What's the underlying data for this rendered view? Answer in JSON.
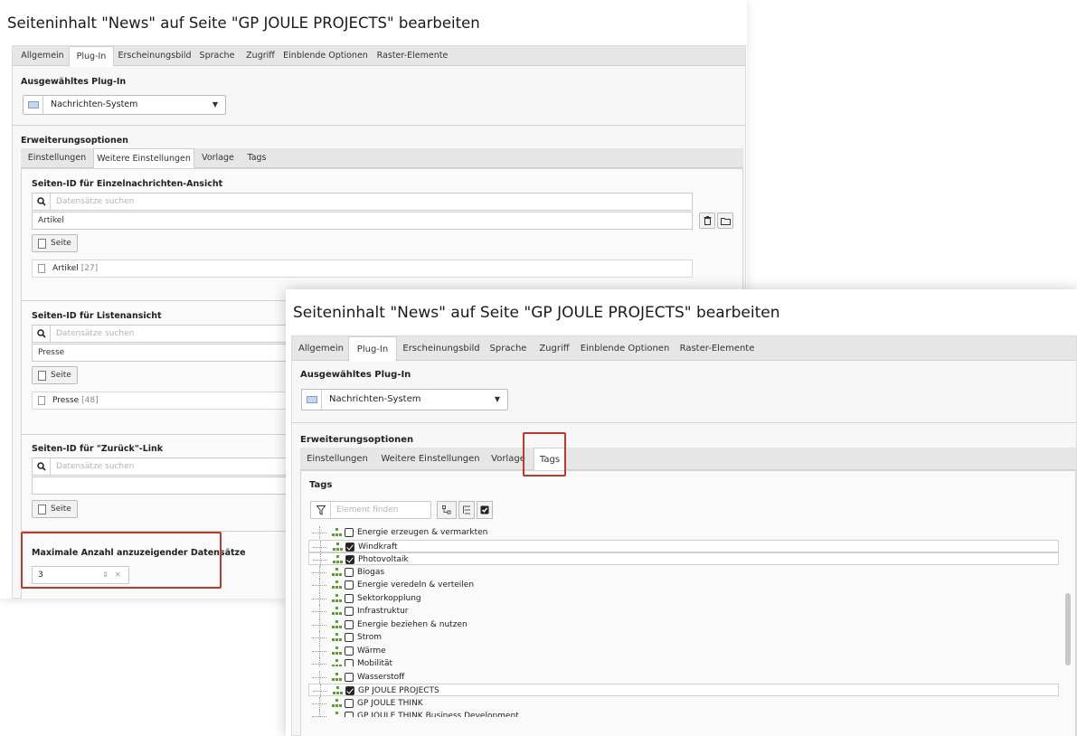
{
  "window1": {
    "title": "Seiteninhalt \"News\" auf Seite \"GP JOULE PROJECTS\" bearbeiten",
    "tabs": [
      "Allgemein",
      "Plug-In",
      "Erscheinungsbild",
      "Sprache",
      "Zugriff",
      "Einblende Optionen",
      "Raster-Elemente"
    ],
    "plugin_section_title": "Ausgewähltes Plug-In",
    "plugin_value": "Nachrichten-System",
    "ext_title": "Erweiterungsoptionen",
    "subtabs": [
      "Einstellungen",
      "Weitere Einstellungen",
      "Vorlage",
      "Tags"
    ],
    "single_view": {
      "title": "Seiten-ID für Einzelnachrichten-Ansicht",
      "search_placeholder": "Datensätze suchen",
      "selected": "Artikel",
      "button": "Seite",
      "record_name": "Artikel",
      "record_id": "[27]"
    },
    "list_view": {
      "title": "Seiten-ID für Listenansicht",
      "search_placeholder": "Datensätze suchen",
      "selected": "Presse",
      "button": "Seite",
      "record_name": "Presse",
      "record_id": "[48]"
    },
    "back_link": {
      "title": "Seiten-ID für \"Zurück\"-Link",
      "search_placeholder": "Datensätze suchen",
      "selected": "",
      "button": "Seite"
    },
    "max_records": {
      "title": "Maximale Anzahl anzuzeigender Datensätze",
      "value": "3"
    }
  },
  "window2": {
    "title": "Seiteninhalt \"News\" auf Seite \"GP JOULE PROJECTS\" bearbeiten",
    "tabs": [
      "Allgemein",
      "Plug-In",
      "Erscheinungsbild",
      "Sprache",
      "Zugriff",
      "Einblende Optionen",
      "Raster-Elemente"
    ],
    "plugin_section_title": "Ausgewähltes Plug-In",
    "plugin_value": "Nachrichten-System",
    "ext_title": "Erweiterungsoptionen",
    "subtabs": [
      "Einstellungen",
      "Weitere Einstellungen",
      "Vorlage",
      "Tags"
    ],
    "tags": {
      "title": "Tags",
      "filter_placeholder": "Element finden",
      "items": [
        {
          "label": "Energie erzeugen & vermarkten",
          "checked": false
        },
        {
          "label": "Windkraft",
          "checked": true
        },
        {
          "label": "Photovoltaik",
          "checked": true
        },
        {
          "label": "Biogas",
          "checked": false
        },
        {
          "label": "Energie veredeln & verteilen",
          "checked": false
        },
        {
          "label": "Sektorkopplung",
          "checked": false
        },
        {
          "label": "Infrastruktur",
          "checked": false
        },
        {
          "label": "Energie beziehen & nutzen",
          "checked": false
        },
        {
          "label": "Strom",
          "checked": false
        },
        {
          "label": "Wärme",
          "checked": false
        },
        {
          "label": "Mobilität",
          "checked": false
        },
        {
          "label": "Wasserstoff",
          "checked": false
        },
        {
          "label": "GP JOULE PROJECTS",
          "checked": true
        },
        {
          "label": "GP JOULE THINK",
          "checked": false
        },
        {
          "label": "GP JOULE THINK Business Development",
          "checked": false
        }
      ]
    }
  },
  "colors": {
    "highlight": "#c0392b",
    "tree_icon": "#5aa02c"
  }
}
